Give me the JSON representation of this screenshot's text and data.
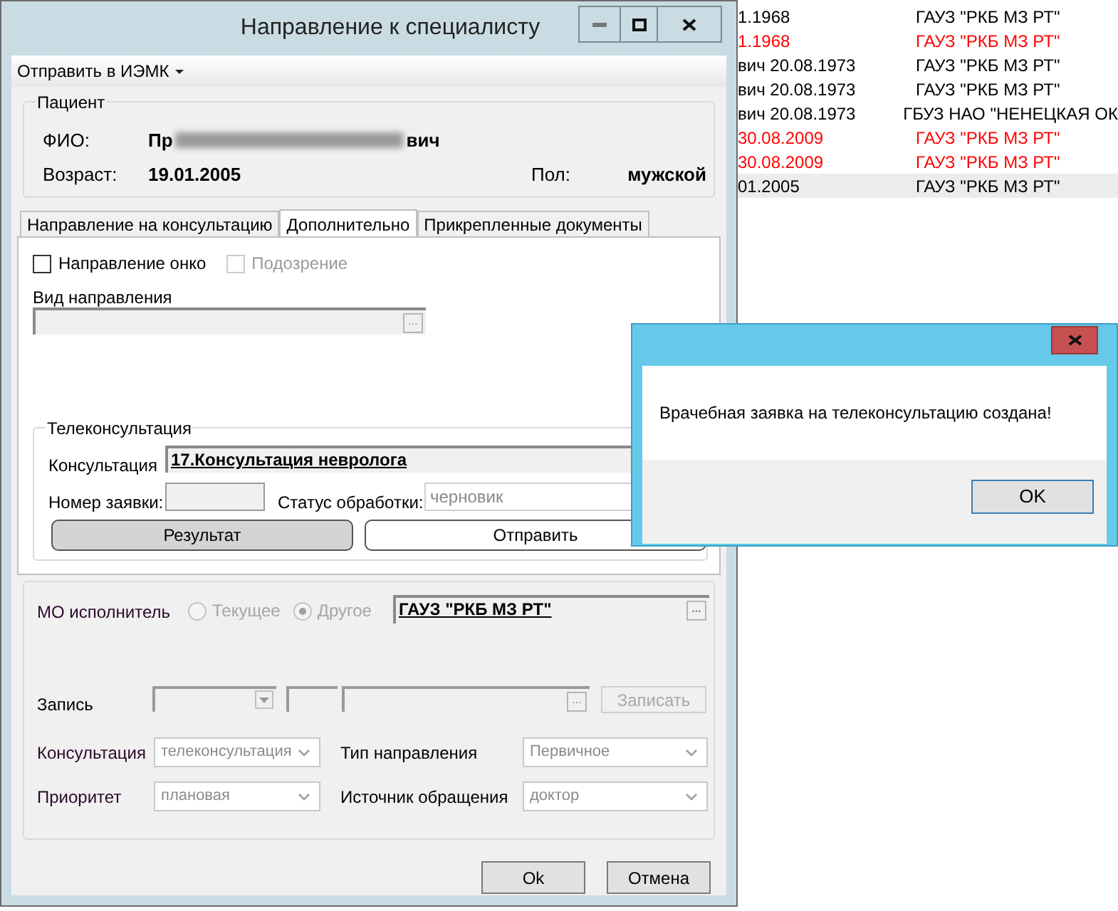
{
  "background_list": {
    "rows": [
      {
        "column_1": "1.1968",
        "column_2": "ГАУЗ \"РКБ МЗ РТ\"",
        "color": "#000000",
        "selected": false
      },
      {
        "column_1": "1.1968",
        "column_2": "ГАУЗ \"РКБ МЗ РТ\"",
        "color": "#ff0000",
        "selected": false
      },
      {
        "column_1": "вич 20.08.1973",
        "column_2": "ГАУЗ \"РКБ МЗ РТ\"",
        "color": "#000000",
        "selected": false
      },
      {
        "column_1": "вич 20.08.1973",
        "column_2": "ГАУЗ \"РКБ МЗ РТ\"",
        "color": "#000000",
        "selected": false
      },
      {
        "column_1": "вич 20.08.1973",
        "column_2": "ГБУЗ НАО \"НЕНЕЦКАЯ ОК",
        "color": "#000000",
        "selected": false
      },
      {
        "column_1": "30.08.2009",
        "column_2": "ГАУЗ \"РКБ МЗ РТ\"",
        "color": "#ff0000",
        "selected": false
      },
      {
        "column_1": "30.08.2009",
        "column_2": "ГАУЗ \"РКБ МЗ РТ\"",
        "color": "#ff0000",
        "selected": false
      },
      {
        "column_1": "01.2005",
        "column_2": "ГАУЗ \"РКБ МЗ РТ\"",
        "color": "#000000",
        "selected": true
      }
    ]
  },
  "dialog": {
    "title": "Направление к специалисту",
    "menu": {
      "label": "Отправить в ИЭМК"
    },
    "patient": {
      "legend": "Пациент",
      "fio_label": "ФИО:",
      "fio_start": "Пр",
      "fio_end": "вич",
      "dob_label": "Возраст:",
      "dob": "19.01.2005",
      "sex_label": "Пол:",
      "sex": "мужской"
    },
    "tabs": [
      {
        "label": "Направление на консультацию",
        "selected": false
      },
      {
        "label": "Дополнительно",
        "selected": true
      },
      {
        "label": "Прикрепленные документы",
        "selected": false
      }
    ],
    "checkboxes": [
      {
        "label": "Направление онко",
        "checked": false,
        "disabled": false
      },
      {
        "label": "Подозрение",
        "checked": false,
        "disabled": true
      }
    ],
    "referral_type": {
      "label": "Вид направления",
      "browse": "..."
    },
    "teleconsultation": {
      "legend": "Телеконсультация",
      "consultation_label": "Консультация",
      "consultation": "17.Консультация невролога",
      "request_label": "Номер заявки:",
      "status_label": "Статус обработки:",
      "status": "черновик",
      "result_button": "Результат",
      "send_button": "Отправить"
    },
    "performer": {
      "label": "МО исполнитель",
      "options": [
        {
          "label": "Текущее",
          "selected": false
        },
        {
          "label": "Другое",
          "selected": true
        }
      ],
      "value": "ГАУЗ \"РКБ МЗ РТ\"",
      "browse": "..."
    },
    "record": {
      "label": "Запись",
      "browse": "...",
      "button": "Записать"
    },
    "selects": [
      {
        "label": "Консультация",
        "value": "телеконсультация"
      },
      {
        "label": "Тип направления",
        "value": "Первичное"
      },
      {
        "label": "Приоритет",
        "value": "плановая"
      },
      {
        "label": "Источник обращения",
        "value": "доктор"
      }
    ],
    "buttons": [
      {
        "label": "Ok"
      },
      {
        "label": "Отмена"
      }
    ]
  },
  "message_box": {
    "text": "Врачебная заявка на телеконсультацию создана!",
    "button": "OK"
  }
}
